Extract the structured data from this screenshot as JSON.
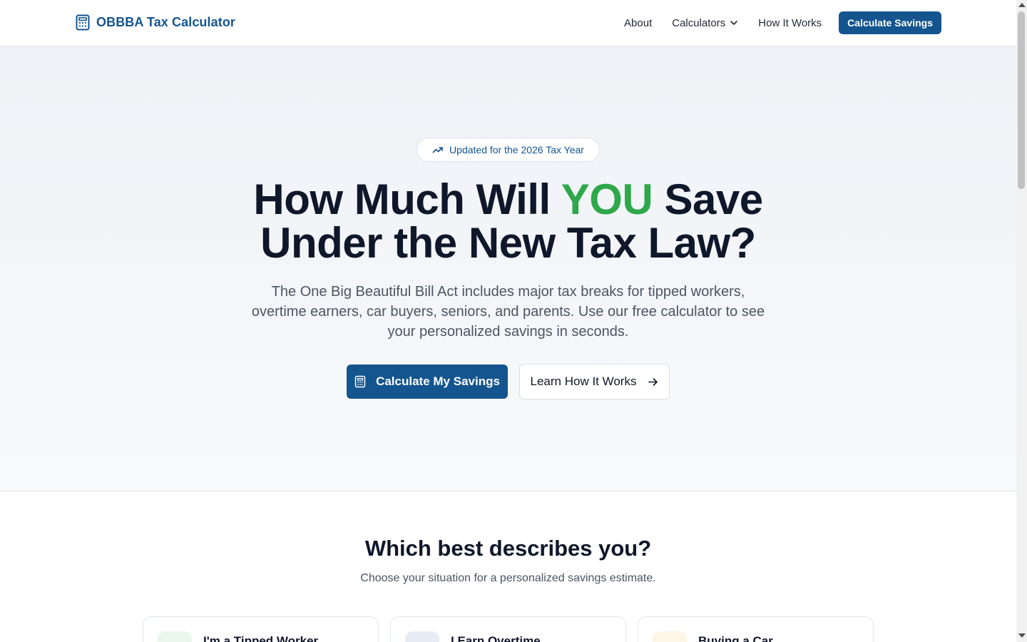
{
  "header": {
    "brand_name": "OBBBA Tax Calculator",
    "brand_icon": "calculator-icon",
    "nav": {
      "about": "About",
      "calculators": "Calculators",
      "how_it_works": "How It Works",
      "cta": "Calculate Savings"
    }
  },
  "hero": {
    "badge": "Updated for the 2026 Tax Year",
    "badge_icon": "trending-up-icon",
    "title_before": "How Much Will ",
    "title_highlight": "YOU",
    "title_after": " Save",
    "title_line2": "Under the New Tax Law?",
    "subtitle": "The One Big Beautiful Bill Act includes major tax breaks for tipped workers, overtime earners, car buyers, seniors, and parents. Use our free calculator to see your personalized savings in seconds.",
    "primary_button": "Calculate My Savings",
    "secondary_button": "Learn How It Works"
  },
  "situations": {
    "title": "Which best describes you?",
    "subtitle": "Choose your situation for a personalized savings estimate.",
    "cards": [
      {
        "title": "I'm a Tipped Worker"
      },
      {
        "title": "I Earn Overtime"
      },
      {
        "title": "Buying a Car"
      }
    ]
  },
  "colors": {
    "brand": "#14558f",
    "highlight": "#2ea84a",
    "text": "#0f172a",
    "muted": "#4b5563"
  }
}
